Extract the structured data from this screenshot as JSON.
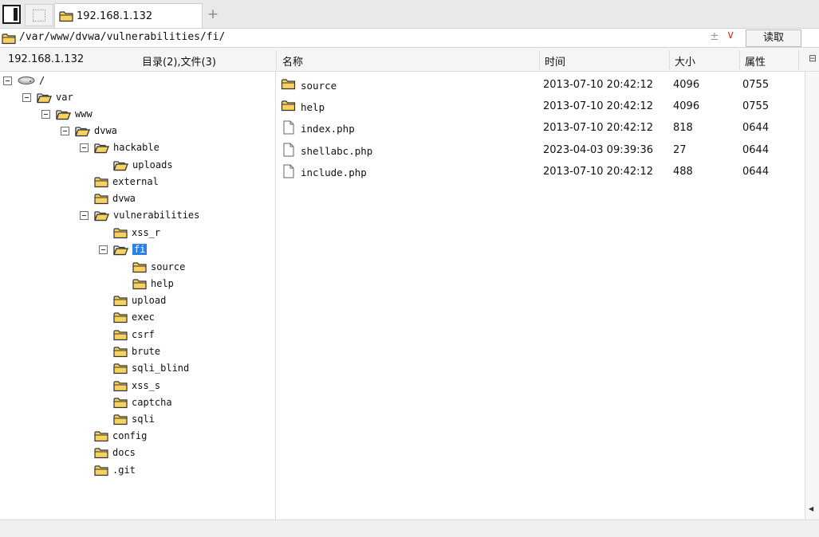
{
  "tabs": {
    "active_label": "192.168.1.132",
    "new_tab_glyph": "+"
  },
  "address": {
    "path": "/var/www/dvwa/vulnerabilities/fi/",
    "plusminus": "±",
    "chevron": "∨",
    "read_button": "读取"
  },
  "header": {
    "host": "192.168.1.132",
    "summary": "目录(2),文件(3)",
    "col_name": "名称",
    "col_time": "时间",
    "col_size": "大小",
    "col_attr": "属性",
    "collapse_glyph": "⊟"
  },
  "tree": [
    {
      "label": "/",
      "icon": "drive-icon"
    },
    {
      "label": "var"
    },
    {
      "label": "www"
    },
    {
      "label": "dvwa"
    },
    {
      "label": "hackable"
    },
    {
      "label": "uploads"
    },
    {
      "label": "external"
    },
    {
      "label": "dvwa"
    },
    {
      "label": "vulnerabilities"
    },
    {
      "label": "xss_r"
    },
    {
      "label": "fi",
      "selected": true
    },
    {
      "label": "source"
    },
    {
      "label": "help"
    },
    {
      "label": "upload"
    },
    {
      "label": "exec"
    },
    {
      "label": "csrf"
    },
    {
      "label": "brute"
    },
    {
      "label": "sqli_blind"
    },
    {
      "label": "xss_s"
    },
    {
      "label": "captcha"
    },
    {
      "label": "sqli"
    },
    {
      "label": "config"
    },
    {
      "label": "docs"
    },
    {
      "label": ".git"
    }
  ],
  "files": [
    {
      "name": "source",
      "type": "folder",
      "time": "2013-07-10 20:42:12",
      "size": "4096",
      "attr": "0755"
    },
    {
      "name": "help",
      "type": "folder",
      "time": "2013-07-10 20:42:12",
      "size": "4096",
      "attr": "0755"
    },
    {
      "name": "index.php",
      "type": "file",
      "time": "2013-07-10 20:42:12",
      "size": "818",
      "attr": "0644"
    },
    {
      "name": "shellabc.php",
      "type": "file",
      "time": "2023-04-03 09:39:36",
      "size": "27",
      "attr": "0644"
    },
    {
      "name": "include.php",
      "type": "file",
      "time": "2013-07-10 20:42:12",
      "size": "488",
      "attr": "0644"
    }
  ],
  "colors": {
    "folder": "#f2c94c",
    "folder_outline": "#3a3a3a",
    "selection": "#2f80e4",
    "accent_red": "#e23838"
  }
}
